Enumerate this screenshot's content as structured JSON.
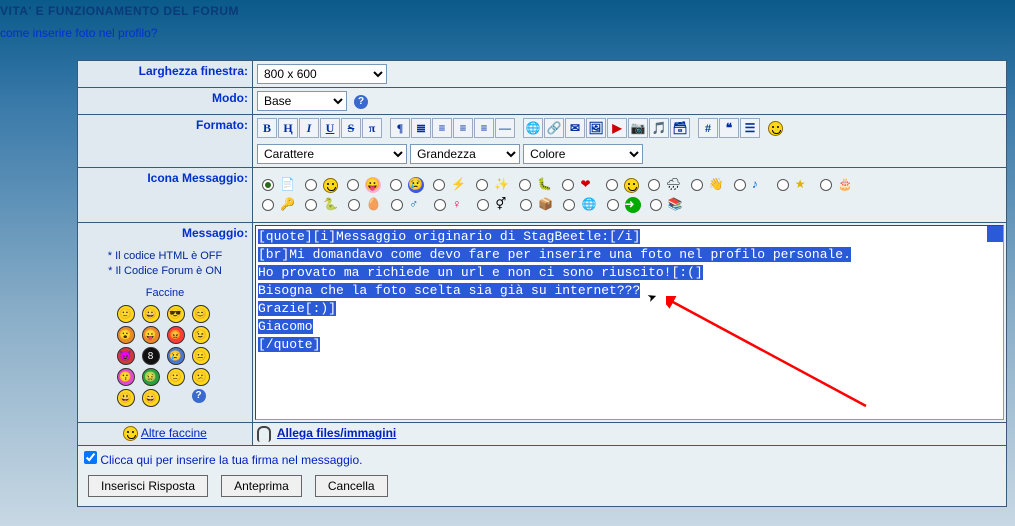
{
  "header": {
    "title": "VITA' E FUNZIONAMENTO DEL FORUM",
    "subtitle": "come inserire foto nel profilo?"
  },
  "labels": {
    "window_width": "Larghezza finestra:",
    "mode": "Modo:",
    "format": "Formato:",
    "icon_msg": "Icona Messaggio:",
    "message": "Messaggio:",
    "html_status": "* Il codice HTML è OFF",
    "forum_status": "* Il Codice Forum è ON",
    "faccine": "Faccine",
    "more_faces": "Altre faccine",
    "attach": "Allega files/immagini",
    "signature": "Clicca qui per inserire la tua firma nel messaggio."
  },
  "selects": {
    "window_width": "800 x 600",
    "mode": "Base",
    "font": "Carattere",
    "size": "Grandezza",
    "color": "Colore"
  },
  "toolbar": [
    "B",
    "Ⱨ",
    "I",
    "U",
    "S",
    "π",
    "¶",
    "≣",
    "≡",
    "≡",
    "≡",
    "—",
    "🌐",
    "🔗",
    "✉",
    "🖼",
    "▶",
    "📷",
    "🎵",
    "🗃",
    "#",
    "❝",
    "☰",
    "☺"
  ],
  "msg_lines": [
    "[quote][i]Messaggio originario di StagBeetle:[/i]",
    "[br]Mi domandavo come devo fare per inserire una foto nel profilo personale.",
    "",
    "Ho provato ma richiede un url e non ci sono riuscito![:(]",
    "Bisogna che la foto scelta sia già su internet???",
    "",
    "Grazie[:)]",
    "",
    "Giacomo",
    "[/quote]"
  ],
  "buttons": {
    "submit": "Inserisci Risposta",
    "preview": "Anteprima",
    "cancel": "Cancella"
  }
}
